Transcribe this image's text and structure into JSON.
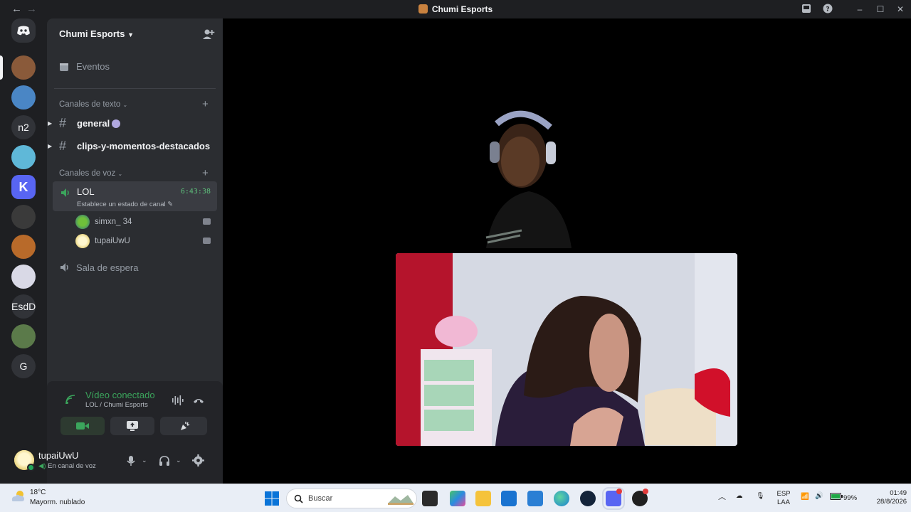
{
  "window": {
    "title": "Chumi Esports",
    "back_icon": "arrow-left-icon",
    "forward_icon": "arrow-right-icon"
  },
  "servers": [
    {
      "type": "image",
      "color": "#8a5a3a"
    },
    {
      "type": "image",
      "color": "#4a86c5"
    },
    {
      "type": "text",
      "label": "n2"
    },
    {
      "type": "image",
      "color": "#5fb8d8"
    },
    {
      "type": "image",
      "color": "#5865f2",
      "glyph": "K"
    },
    {
      "type": "image",
      "color": "#3a3a3a"
    },
    {
      "type": "image",
      "color": "#b86a2a"
    },
    {
      "type": "image",
      "color": "#d9d9e6"
    },
    {
      "type": "text",
      "label": "EsdD"
    },
    {
      "type": "image",
      "color": "#5b7a4a"
    },
    {
      "type": "text",
      "label": "G"
    }
  ],
  "sidebar": {
    "guild_name": "Chumi Esports",
    "events_label": "Eventos",
    "text_category": "Canales de texto",
    "text_channels": [
      {
        "name": "general"
      },
      {
        "name": "clips-y-momentos-destacados"
      }
    ],
    "voice_category": "Canales de voz",
    "active_voice": {
      "name": "LOL",
      "timer": "6:43:38",
      "status": "Establece un estado de canal"
    },
    "members": [
      {
        "name": "simxn_ 34"
      },
      {
        "name": "tupaiUwU"
      }
    ],
    "idle_voice": "Sala de espera"
  },
  "voice_panel": {
    "title": "Vídeo conectado",
    "subtitle": "LOL / Chumi Esports"
  },
  "user_panel": {
    "username": "tupaiUwU",
    "status": "En canal de voz"
  },
  "taskbar": {
    "temperature": "18°C",
    "condition": "Mayorm. nublado",
    "search_placeholder": "Buscar",
    "lang_top": "ESP",
    "lang_bottom": "LAA",
    "battery": "99%",
    "time": "01:49",
    "date": "28/8/2026"
  },
  "colors": {
    "accent_green": "#3ba55c",
    "blurple": "#5865f2"
  }
}
